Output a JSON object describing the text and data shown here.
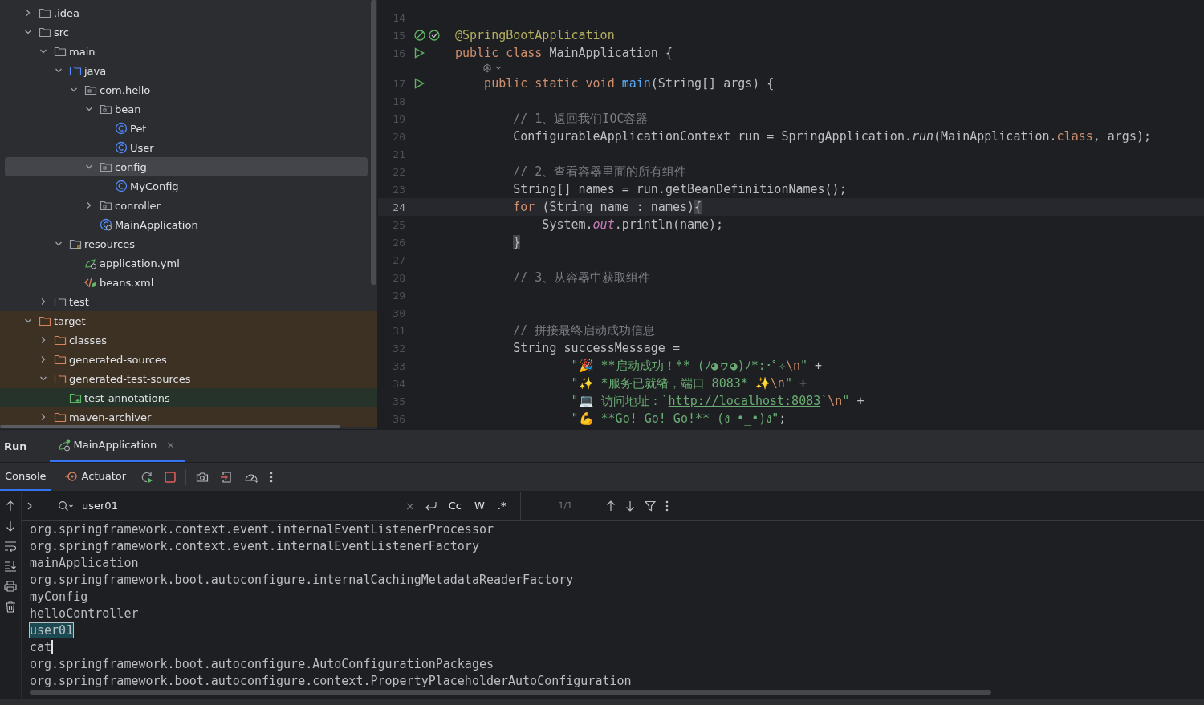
{
  "project_tree": [
    {
      "label": ".idea",
      "kind": "folder",
      "expanded": false,
      "selected": false
    },
    {
      "label": "src",
      "kind": "folder",
      "expanded": true,
      "selected": false,
      "children": [
        {
          "label": "main",
          "kind": "folder",
          "expanded": true,
          "selected": false,
          "children": [
            {
              "label": "java",
              "kind": "source-folder",
              "expanded": true,
              "selected": false,
              "children": [
                {
                  "label": "com.hello",
                  "kind": "package",
                  "expanded": true,
                  "selected": false,
                  "children": [
                    {
                      "label": "bean",
                      "kind": "package",
                      "expanded": true,
                      "selected": false,
                      "children": [
                        {
                          "label": "Pet",
                          "kind": "class",
                          "selected": false
                        },
                        {
                          "label": "User",
                          "kind": "class",
                          "selected": false
                        }
                      ]
                    },
                    {
                      "label": "config",
                      "kind": "package",
                      "expanded": true,
                      "selected": true,
                      "children": [
                        {
                          "label": "MyConfig",
                          "kind": "class",
                          "selected": false
                        }
                      ]
                    },
                    {
                      "label": "conroller",
                      "kind": "package",
                      "expanded": false,
                      "selected": false
                    },
                    {
                      "label": "MainApplication",
                      "kind": "app-class",
                      "selected": false
                    }
                  ]
                }
              ]
            },
            {
              "label": "resources",
              "kind": "resources",
              "expanded": true,
              "selected": false,
              "children": [
                {
                  "label": "application.yml",
                  "kind": "yml",
                  "selected": false
                },
                {
                  "label": "beans.xml",
                  "kind": "xml",
                  "selected": false
                }
              ]
            }
          ]
        },
        {
          "label": "test",
          "kind": "folder",
          "expanded": false,
          "selected": false
        }
      ]
    },
    {
      "label": "target",
      "kind": "excluded-folder",
      "expanded": true,
      "selected": false,
      "children": [
        {
          "label": "classes",
          "kind": "excluded-folder",
          "expanded": false,
          "selected": false
        },
        {
          "label": "generated-sources",
          "kind": "excluded-folder",
          "expanded": false,
          "selected": false
        },
        {
          "label": "generated-test-sources",
          "kind": "excluded-folder",
          "expanded": true,
          "selected": false,
          "children": [
            {
              "label": "test-annotations",
              "kind": "generated-folder",
              "selected": false
            }
          ]
        },
        {
          "label": "maven-archiver",
          "kind": "excluded-folder",
          "expanded": false,
          "selected": false
        }
      ]
    }
  ],
  "editor": {
    "lines": [
      {
        "number": "14",
        "current": false
      },
      {
        "number": "15",
        "current": false,
        "gutter": {
          "kind": "bean"
        },
        "tokens": [
          {
            "kind": "annotation",
            "text": "@SpringBootApplication"
          }
        ]
      },
      {
        "number": "16",
        "current": false,
        "gutter": {
          "kind": "run"
        },
        "inlay_after": true,
        "tokens": [
          {
            "kind": "keyword",
            "text": "public class "
          },
          {
            "kind": "plain",
            "text": "MainApplication {"
          }
        ]
      },
      {
        "number": "17",
        "current": false,
        "gutter": {
          "kind": "run"
        },
        "tokens": [
          {
            "kind": "keyword",
            "text": "    public static void "
          },
          {
            "kind": "function",
            "text": "main"
          },
          {
            "kind": "plain",
            "text": "(String[] args) {"
          }
        ]
      },
      {
        "number": "18",
        "current": false
      },
      {
        "number": "19",
        "current": false,
        "tokens": [
          {
            "kind": "comment",
            "text": "        // 1、返回我们IOC容器"
          }
        ]
      },
      {
        "number": "20",
        "current": false,
        "tokens": [
          {
            "kind": "plain",
            "text": "        ConfigurableApplicationContext run = SpringApplication."
          },
          {
            "kind": "italic",
            "text": "run"
          },
          {
            "kind": "plain",
            "text": "(MainApplication."
          },
          {
            "kind": "keyword",
            "text": "class"
          },
          {
            "kind": "plain",
            "text": ", args);"
          }
        ]
      },
      {
        "number": "21",
        "current": false
      },
      {
        "number": "22",
        "current": false,
        "tokens": [
          {
            "kind": "comment",
            "text": "        // 2、查看容器里面的所有组件"
          }
        ]
      },
      {
        "number": "23",
        "current": false,
        "tokens": [
          {
            "kind": "plain",
            "text": "        String[] names = run.getBeanDefinitionNames();"
          }
        ]
      },
      {
        "number": "24",
        "current": true,
        "tokens": [
          {
            "kind": "keyword",
            "text": "        for "
          },
          {
            "kind": "plain",
            "text": "(String name : names)"
          },
          {
            "kind": "brace",
            "text": "{"
          }
        ]
      },
      {
        "number": "25",
        "current": false,
        "tokens": [
          {
            "kind": "plain",
            "text": "            System."
          },
          {
            "kind": "static",
            "text": "out"
          },
          {
            "kind": "plain",
            "text": ".println(name);"
          }
        ]
      },
      {
        "number": "26",
        "current": false,
        "tokens": [
          {
            "kind": "brace",
            "text": "        }"
          }
        ]
      },
      {
        "number": "27",
        "current": false
      },
      {
        "number": "28",
        "current": false,
        "tokens": [
          {
            "kind": "comment",
            "text": "        // 3、从容器中获取组件"
          }
        ]
      },
      {
        "number": "29",
        "current": false
      },
      {
        "number": "30",
        "current": false
      },
      {
        "number": "31",
        "current": false,
        "tokens": [
          {
            "kind": "comment",
            "text": "        // 拼接最终启动成功信息"
          }
        ]
      },
      {
        "number": "32",
        "current": false,
        "tokens": [
          {
            "kind": "plain",
            "text": "        String successMessage ="
          }
        ]
      },
      {
        "number": "33",
        "current": false,
        "tokens": [
          {
            "kind": "string",
            "text": "                \"🎉 **启动成功！** (ﾉ◕ヮ◕)ﾉ*:･ﾟ✧"
          },
          {
            "kind": "escape",
            "text": "\\n"
          },
          {
            "kind": "string",
            "text": "\""
          },
          {
            "kind": "plain",
            "text": " +"
          }
        ]
      },
      {
        "number": "34",
        "current": false,
        "tokens": [
          {
            "kind": "string",
            "text": "                \"✨ *服务已就绪，端口 8083* ✨"
          },
          {
            "kind": "escape",
            "text": "\\n"
          },
          {
            "kind": "string",
            "text": "\""
          },
          {
            "kind": "plain",
            "text": " +"
          }
        ]
      },
      {
        "number": "35",
        "current": false,
        "tokens": [
          {
            "kind": "string",
            "text": "                \"💻 访问地址：`"
          },
          {
            "kind": "link",
            "text": "http://localhost:8083"
          },
          {
            "kind": "string",
            "text": "`"
          },
          {
            "kind": "escape",
            "text": "\\n"
          },
          {
            "kind": "string",
            "text": "\""
          },
          {
            "kind": "plain",
            "text": " +"
          }
        ]
      },
      {
        "number": "36",
        "current": false,
        "tokens": [
          {
            "kind": "string",
            "text": "                \"💪 **Go! Go! Go!** (ง •_•)ง\""
          },
          {
            "kind": "plain",
            "text": ";"
          }
        ]
      }
    ]
  },
  "run_panel": {
    "title": "Run",
    "tabs": [
      {
        "label": "MainApplication",
        "selected": true,
        "close": "×"
      }
    ],
    "subtabs": [
      {
        "label": "Console",
        "kind": "console",
        "selected": true
      },
      {
        "label": "Actuator",
        "kind": "actuator",
        "selected": false
      }
    ],
    "search": {
      "value": "user01",
      "clear": "×",
      "toggles": [
        {
          "label": "Cc",
          "on": false
        },
        {
          "label": "W",
          "on": false
        },
        {
          "label": ".*",
          "on": false
        }
      ],
      "matches": "1/1"
    },
    "console_lines": [
      {
        "text": "org.springframework.context.event.internalEventListenerProcessor",
        "match": false,
        "caret": false
      },
      {
        "text": "org.springframework.context.event.internalEventListenerFactory",
        "match": false,
        "caret": false
      },
      {
        "text": "mainApplication",
        "match": false,
        "caret": false
      },
      {
        "text": "org.springframework.boot.autoconfigure.internalCachingMetadataReaderFactory",
        "match": false,
        "caret": false
      },
      {
        "text": "myConfig",
        "match": false,
        "caret": false
      },
      {
        "text": "helloController",
        "match": false,
        "caret": false
      },
      {
        "text": "user01",
        "match": true,
        "caret": false
      },
      {
        "text": "cat",
        "match": false,
        "caret": true
      },
      {
        "text": "org.springframework.boot.autoconfigure.AutoConfigurationPackages",
        "match": false,
        "caret": false
      },
      {
        "text": "org.springframework.boot.autoconfigure.context.PropertyPlaceholderAutoConfiguration",
        "match": false,
        "caret": false
      }
    ]
  }
}
